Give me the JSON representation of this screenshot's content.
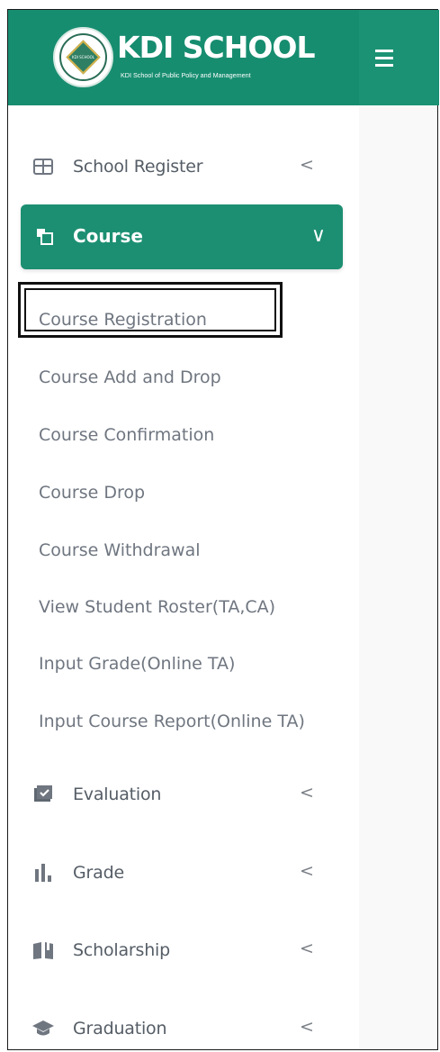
{
  "header": {
    "logo_title": "KDI SCHOOL",
    "logo_subtitle": "KDI School of Public Policy and Management",
    "logo_seal_text": "KDI SCHOOL",
    "brand_color": "#188e71"
  },
  "sidebar": {
    "items": [
      {
        "label": "School Register",
        "icon": "calendar-grid-icon",
        "chevron": "<"
      },
      {
        "label": "Course",
        "icon": "stacked-pages-icon",
        "chevron": "∨",
        "active": true
      },
      {
        "label": "Evaluation",
        "icon": "checked-image-icon",
        "chevron": "<"
      },
      {
        "label": "Grade",
        "icon": "bar-chart-icon",
        "chevron": "<"
      },
      {
        "label": "Scholarship",
        "icon": "open-book-icon",
        "chevron": "<"
      },
      {
        "label": "Graduation",
        "icon": "graduation-cap-icon",
        "chevron": "<"
      }
    ],
    "course_subitems": [
      "Course Registration",
      "Course Add and Drop",
      "Course Confirmation",
      "Course Drop",
      "Course Withdrawal",
      "View Student Roster(TA,CA)",
      "Input Grade(Online TA)",
      "Input Course Report(Online TA)"
    ],
    "selected_subitem": "Course Registration",
    "active_color": "#1c8f72",
    "text_color": "#6f7680"
  }
}
